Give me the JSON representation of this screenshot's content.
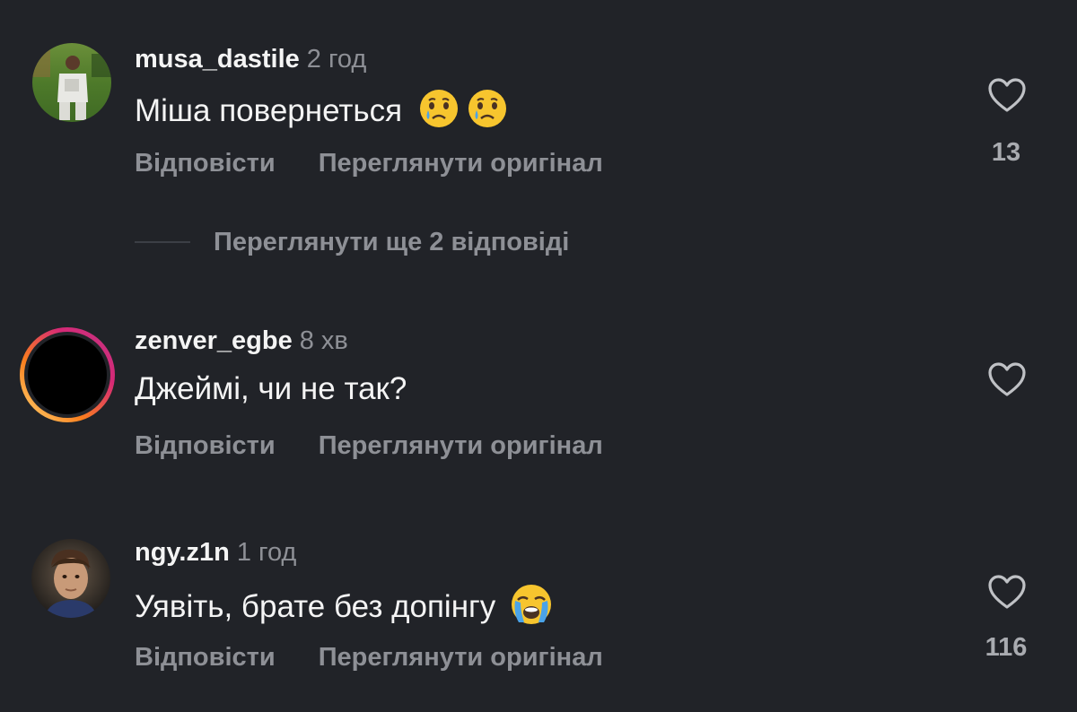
{
  "comments": [
    {
      "username": "musa_dastile",
      "time": "2 год",
      "text": "Міша повернеться",
      "reply_label": "Відповісти",
      "original_label": "Переглянути оригінал",
      "likes": "13",
      "emojis": [
        "crying-face",
        "crying-face"
      ]
    },
    {
      "username": "zenver_egbe",
      "time": "8 хв",
      "text": "Джеймі, чи не так?",
      "reply_label": "Відповісти",
      "original_label": "Переглянути оригінал",
      "likes": "",
      "emojis": []
    },
    {
      "username": "ngy.z1n",
      "time": "1 год",
      "text": "Уявіть, брате без допінгу",
      "reply_label": "Відповісти",
      "original_label": "Переглянути оригінал",
      "likes": "116",
      "emojis": [
        "loudly-crying-face"
      ]
    }
  ],
  "more_replies": "Переглянути ще 2 відповіді",
  "colors": {
    "background": "#212328",
    "primary_text": "#f4f4f4",
    "secondary_text": "#8e9096",
    "story_ring_start": "#feda75",
    "story_ring_end": "#d62976"
  }
}
